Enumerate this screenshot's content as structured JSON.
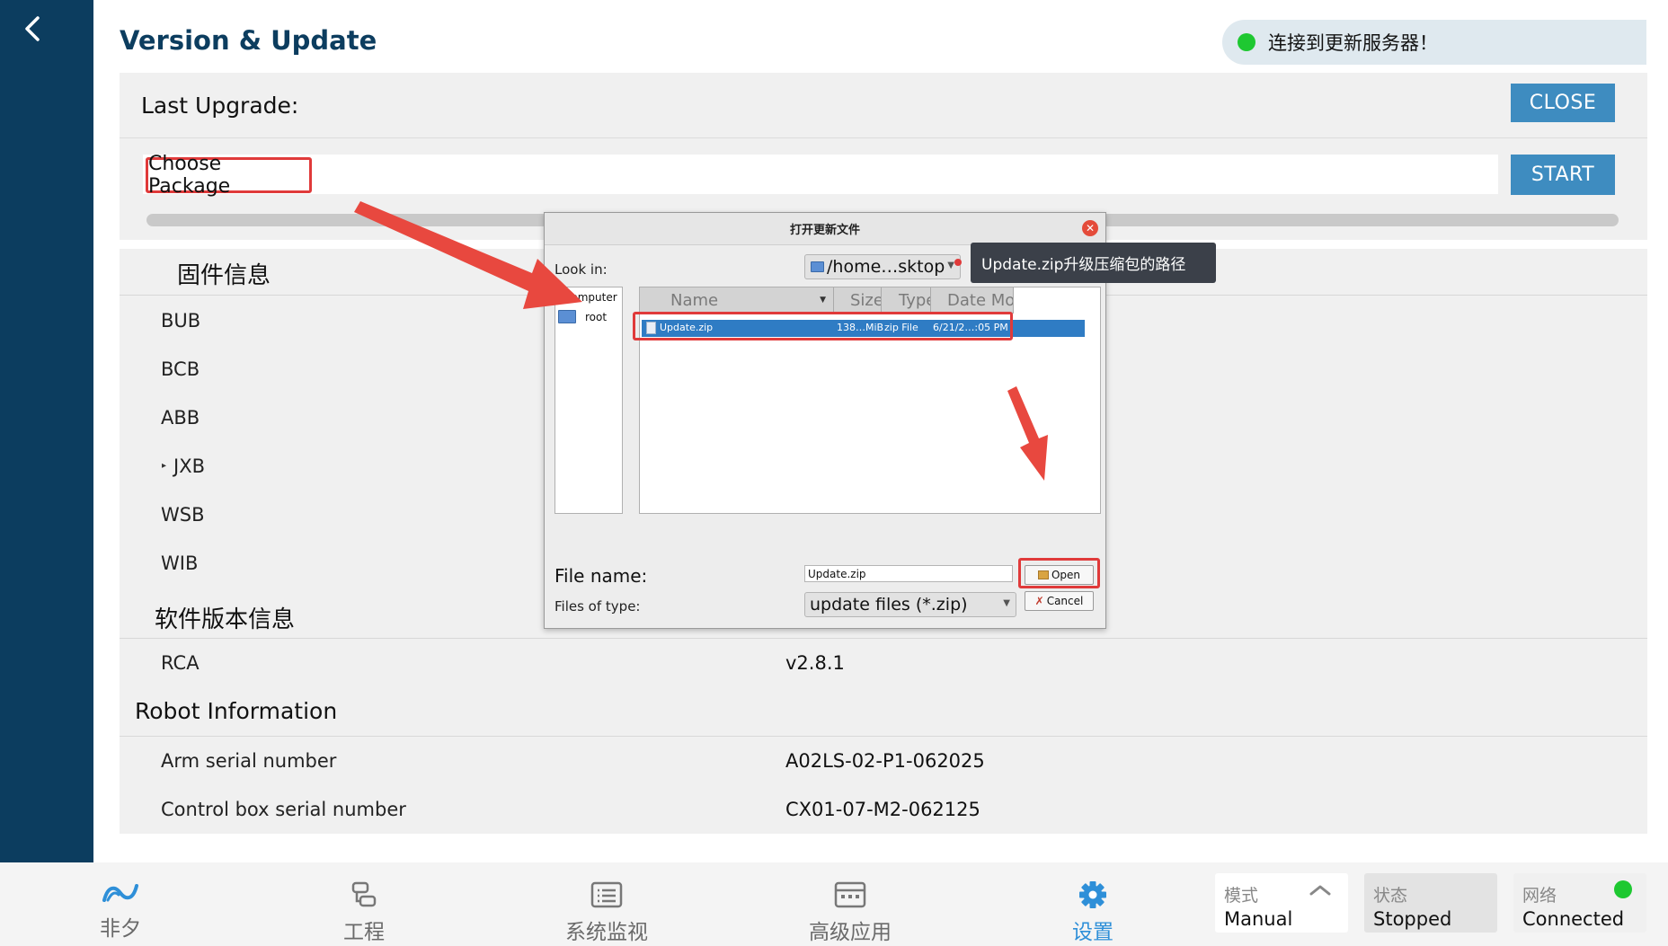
{
  "page": {
    "title": "Version & Update"
  },
  "server": {
    "status_text": "连接到更新服务器！",
    "status_color": "#1ec831"
  },
  "last_upgrade": {
    "label": "Last Upgrade:",
    "close_label": "CLOSE"
  },
  "package": {
    "choose_label": "Choose Package",
    "start_label": "START"
  },
  "firmware": {
    "title": "固件信息",
    "items": [
      "BUB",
      "BCB",
      "ABB",
      "JXB",
      "WSB",
      "WIB"
    ]
  },
  "software": {
    "title": "软件版本信息",
    "items": [
      {
        "label": "RCA",
        "value": "v2.8.1"
      }
    ]
  },
  "robot": {
    "title": "Robot Information",
    "items": [
      {
        "label": "Arm serial number",
        "value": "A02LS-02-P1-062025"
      },
      {
        "label": "Control box serial number",
        "value": "CX01-07-M2-062125"
      }
    ]
  },
  "dialog": {
    "title": "打开更新文件",
    "look_in_label": "Look in:",
    "look_in_value": "/home…sktop",
    "tooltip": "Update.zip升级压缩包的路径",
    "places": [
      "Computer",
      "root"
    ],
    "columns": [
      "Name",
      "Size",
      "Type",
      "Date Mod"
    ],
    "files": [
      {
        "name": "Update.zip",
        "size": "138…MiB",
        "type": "zip File",
        "date": "6/21/2…:05 PM"
      }
    ],
    "file_name_label": "File name:",
    "file_name_value": "Update.zip",
    "files_of_type_label": "Files of type:",
    "files_of_type_value": "update files (*.zip)",
    "open_label": "Open",
    "cancel_label": "Cancel"
  },
  "bottom_nav": {
    "tabs": [
      {
        "label": "非夕",
        "icon": "flexiv-logo-icon"
      },
      {
        "label": "工程",
        "icon": "project-icon"
      },
      {
        "label": "系统监视",
        "icon": "monitor-icon"
      },
      {
        "label": "高级应用",
        "icon": "advanced-apps-icon"
      },
      {
        "label": "设置",
        "icon": "gear-icon",
        "active": true
      }
    ],
    "active_color": "#2e8fd8"
  },
  "status_panels": {
    "mode": {
      "key": "模式",
      "value": "Manual"
    },
    "state": {
      "key": "状态",
      "value": "Stopped"
    },
    "network": {
      "key": "网络",
      "value": "Connected",
      "indicator_color": "#1ec831"
    }
  }
}
